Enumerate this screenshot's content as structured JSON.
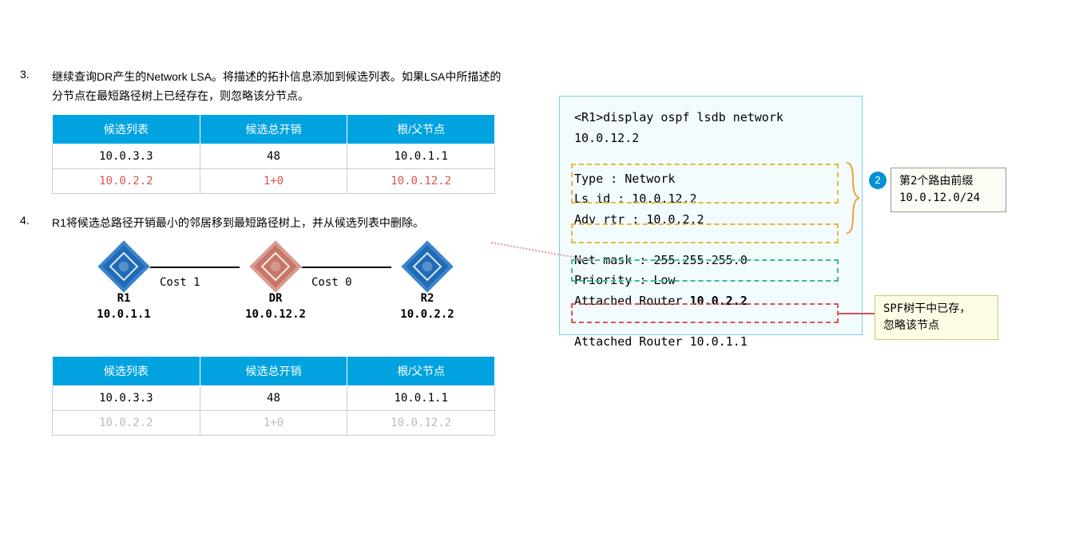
{
  "step3": {
    "num": "3.",
    "text": "继续查询DR产生的Network LSA。将描述的拓扑信息添加到候选列表。如果LSA中所描述的分节点在最短路径树上已经存在，则忽略该分节点。"
  },
  "step4": {
    "num": "4.",
    "text": "R1将候选总路径开销最小的邻居移到最短路径树上，并从候选列表中删除。"
  },
  "table_headers": {
    "c1": "候选列表",
    "c2": "候选总开销",
    "c3": "根/父节点"
  },
  "table1": {
    "r1": {
      "c1": "10.0.3.3",
      "c2": "48",
      "c3": "10.0.1.1"
    },
    "r2": {
      "c1": "10.0.2.2",
      "c2": "1+0",
      "c3": "10.0.12.2"
    }
  },
  "table2": {
    "r1": {
      "c1": "10.0.3.3",
      "c2": "48",
      "c3": "10.0.1.1"
    },
    "r2": {
      "c1": "10.0.2.2",
      "c2": "1+0",
      "c3": "10.0.12.2"
    }
  },
  "topo": {
    "n1": {
      "name": "R1",
      "ip": "10.0.1.1"
    },
    "n2": {
      "name": "DR",
      "ip": "10.0.12.2"
    },
    "n3": {
      "name": "R2",
      "ip": "10.0.2.2"
    },
    "cost1": "Cost 1",
    "cost2": "Cost 0"
  },
  "cli": {
    "cmd": "<R1>display ospf lsdb network 10.0.12.2",
    "type": "Type      : Network",
    "lsid": "Ls id     : 10.0.12.2",
    "advrtr": "Adv rtr   : 10.0.2.2",
    "mask": "Net mask  : 255.255.255.0",
    "prio": "  Priority  : Low",
    "ar1a": "     Attached Router ",
    "ar1b": "10.0.2.2",
    "ar2a": "     Attached Router ",
    "ar2b": "10.0.1.1"
  },
  "badge": "2",
  "annot1": {
    "l1": "第2个路由前缀",
    "l2": "10.0.12.0/24"
  },
  "annot2": {
    "l1": "SPF树干中已存，",
    "l2": "忽略该节点"
  }
}
